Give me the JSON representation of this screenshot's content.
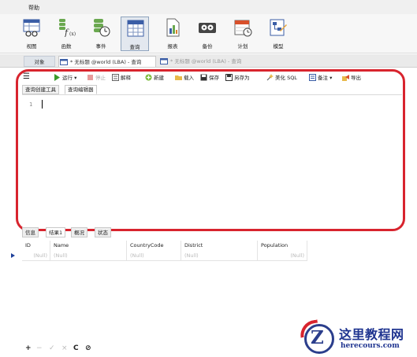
{
  "menu": {
    "help": "帮助"
  },
  "ribbon": {
    "buttons": [
      {
        "label": "视图",
        "icon": "view-icon"
      },
      {
        "label": "函数",
        "icon": "function-icon"
      },
      {
        "label": "事件",
        "icon": "event-icon"
      },
      {
        "label": "查询",
        "icon": "query-icon",
        "active": true
      },
      {
        "label": "报表",
        "icon": "report-icon"
      },
      {
        "label": "备份",
        "icon": "backup-icon"
      },
      {
        "label": "计划",
        "icon": "schedule-icon"
      },
      {
        "label": "模型",
        "icon": "model-icon"
      }
    ]
  },
  "tabs": {
    "object": "对象",
    "tab1": "* 无标题 @world (LBA) - 查询",
    "tab2": "* 无标题 @world (LBA) - 查询"
  },
  "toolbar": {
    "menu_glyph": "☰",
    "run": "运行",
    "run_arrow": "▾",
    "stop": "停止",
    "explain": "解释",
    "new": "新建",
    "load": "载入",
    "save": "保存",
    "save_as": "另存为",
    "beautify": "美化 SQL",
    "comment": "备注",
    "comment_arrow": "▾",
    "export": "导出"
  },
  "editor_tabs": {
    "builder": "查询创建工具",
    "editor": "查询编辑器"
  },
  "editor": {
    "line_number": "1"
  },
  "result_tabs": {
    "info": "信息",
    "result1": "结果1",
    "profile": "概况",
    "status": "状态"
  },
  "grid": {
    "columns": [
      "ID",
      "Name",
      "CountryCode",
      "District",
      "Population"
    ],
    "row": [
      "(Null)",
      "(Null)",
      "(Null)",
      "(Null)",
      "(Null)"
    ]
  },
  "bottom": {
    "add": "+",
    "remove": "−",
    "apply": "✓",
    "discard": "×",
    "refresh": "C",
    "stop": "⊘"
  },
  "watermark": {
    "site": "这里教程网",
    "url": "herecours.com",
    "logo_letter": "Z"
  },
  "colors": {
    "highlight": "#d8242e",
    "brand": "#1f3490"
  }
}
